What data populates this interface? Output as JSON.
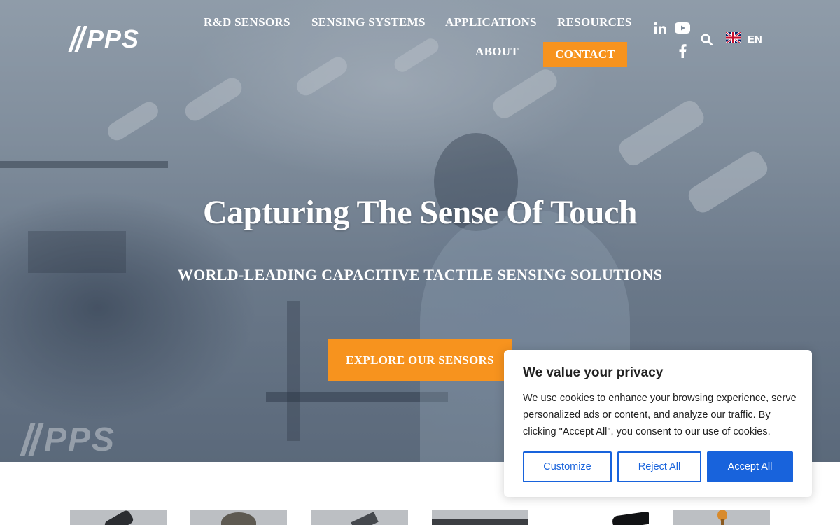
{
  "brand": {
    "logo_text": "PPS",
    "accent": "#f7931e",
    "cookie_accent": "#1863dc"
  },
  "nav": {
    "items": [
      {
        "label": "R&D SENSORS"
      },
      {
        "label": "SENSING SYSTEMS"
      },
      {
        "label": "APPLICATIONS"
      },
      {
        "label": "RESOURCES"
      },
      {
        "label": "ABOUT"
      }
    ],
    "contact_label": "CONTACT",
    "social": [
      "linkedin-icon",
      "youtube-icon",
      "facebook-icon"
    ],
    "search_icon": "search-icon",
    "language": {
      "flag": "uk-flag-icon",
      "code": "EN"
    }
  },
  "hero": {
    "title": "Capturing The Sense Of Touch",
    "subtitle": "WORLD-LEADING CAPACITIVE TACTILE SENSING SOLUTIONS",
    "cta_label": "EXPLORE OUR SENSORS",
    "watermark_text": "PPS"
  },
  "products": {
    "count_visible": 6
  },
  "cookie": {
    "title": "We value your privacy",
    "text": "We use cookies to enhance your browsing experience, serve personalized ads or content, and analyze our traffic. By clicking \"Accept All\", you consent to our use of cookies.",
    "customize_label": "Customize",
    "reject_label": "Reject All",
    "accept_label": "Accept All"
  }
}
